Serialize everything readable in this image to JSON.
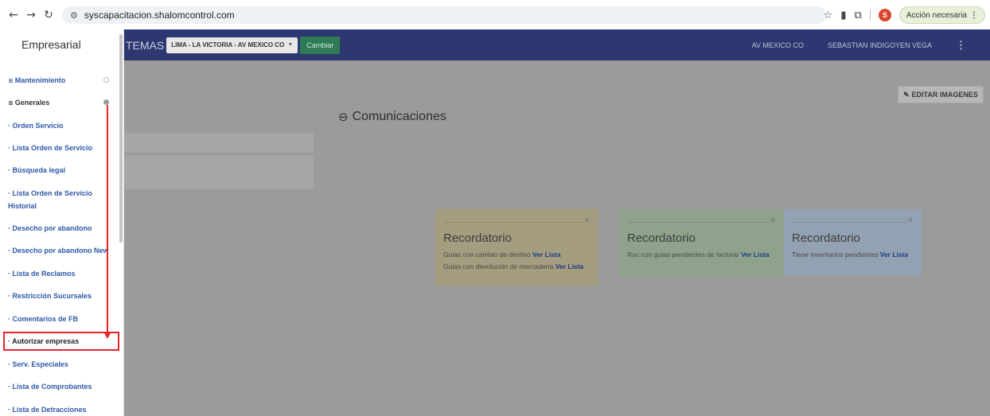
{
  "browser": {
    "back_icon": "arrow-left-icon",
    "forward_icon": "arrow-right-icon",
    "reload_icon": "reload-icon",
    "url": "syscapacitacion.shalomcontrol.com",
    "profile_letter": "S",
    "action_label": "Acción necesaria"
  },
  "topnav": {
    "brand_fragment": "TEMAS",
    "branch": "LIMA - LA VICTORIA - AV MEXICO CO",
    "change_label": "Cambiar",
    "location": "AV MEXICO CO",
    "user": "SEBASTIAN INDIGOYEN VEGA"
  },
  "main": {
    "edit_images_label": "EDITAR IMAGENES",
    "section_title": "Comunicaciones"
  },
  "cards": [
    {
      "title": "Recordatorio",
      "lines": [
        {
          "text": "Guias con cambio de destino",
          "link": "Ver Lista"
        },
        {
          "text": "Guias con devolución de mercadería",
          "link": "Ver Lista"
        }
      ]
    },
    {
      "title": "Recordatorio",
      "lines": [
        {
          "text": "Ruc con guias pendientes de facturar",
          "link": "Ver Lista"
        }
      ]
    },
    {
      "title": "Recordatorio",
      "lines": [
        {
          "text": "Tiene inventarios pendientes",
          "link": "Ver Lista"
        }
      ]
    }
  ],
  "sidebar": {
    "title": "Empresarial",
    "groups": [
      {
        "label": "Mantenimiento"
      },
      {
        "label": "Generales"
      }
    ],
    "items": [
      {
        "label": "· Orden Servicio"
      },
      {
        "label": "· Lista Orden de Servicio"
      },
      {
        "label": "· Búsqueda legal"
      },
      {
        "label": "· Lista Orden de Servicio",
        "label2": "Historial"
      },
      {
        "label": "· Desecho por abandono"
      },
      {
        "label": "· Desecho por abandono New"
      },
      {
        "label": "· Lista de Reclamos"
      },
      {
        "label": "· Restricción Sucursales"
      },
      {
        "label": "· Comentarios de FB"
      },
      {
        "label": "· Autorizar empresas"
      },
      {
        "label": "· Serv. Especiales"
      },
      {
        "label": "· Lista de Comprobantes"
      },
      {
        "label": "· Lista de Detracciones"
      }
    ]
  },
  "colors": {
    "nav_bg": "#2d3870",
    "highlight": "#e5262b",
    "link": "#2f59a7"
  }
}
